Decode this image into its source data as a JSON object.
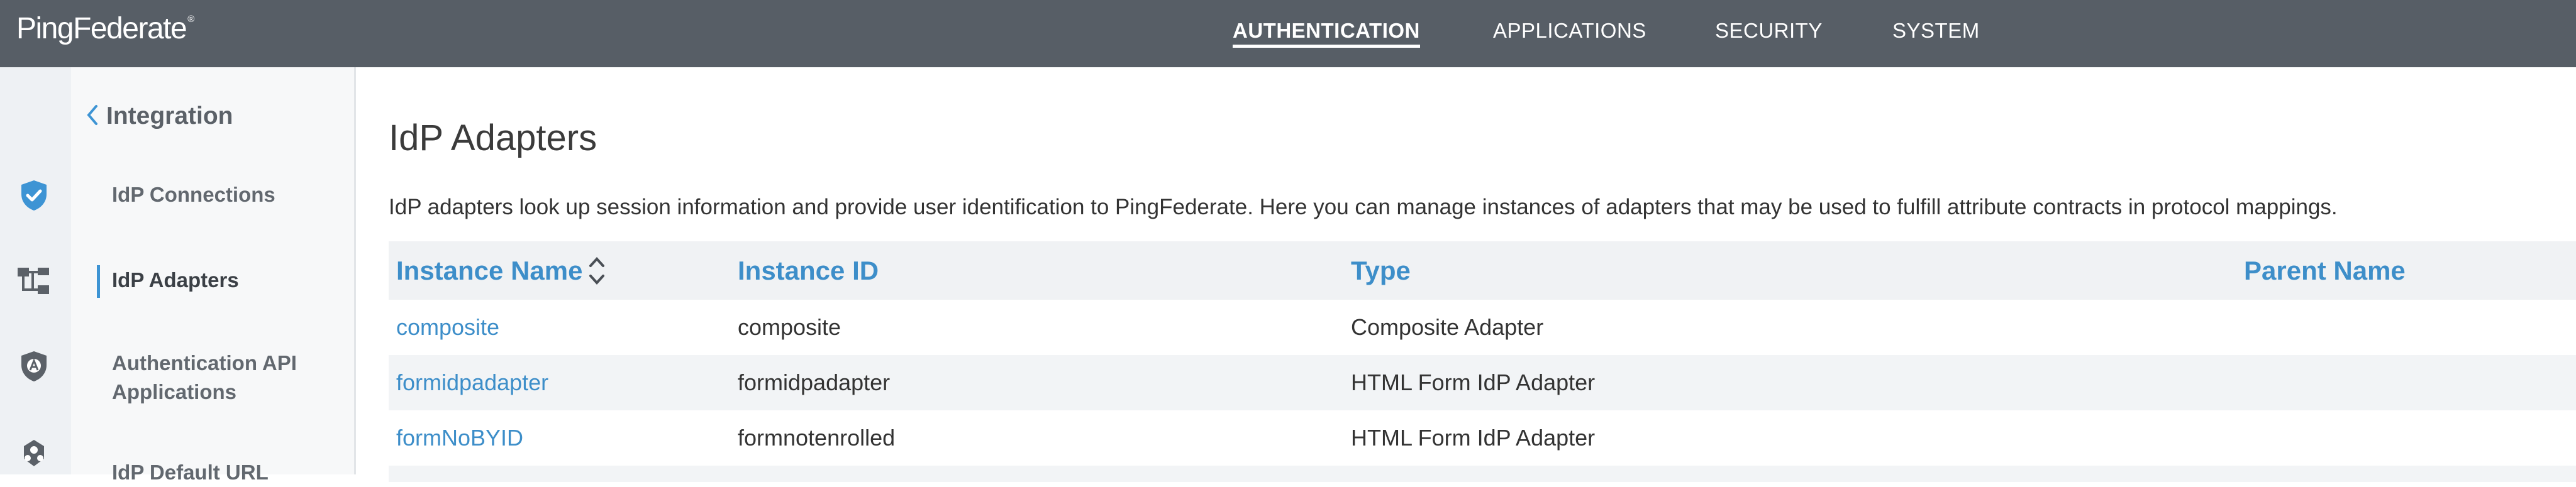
{
  "app": {
    "logo_text": "PingFederate",
    "logo_mark": "®"
  },
  "topnav": {
    "authentication": "AUTHENTICATION",
    "applications": "APPLICATIONS",
    "security": "SECURITY",
    "system": "SYSTEM",
    "active": "AUTHENTICATION"
  },
  "rail": {
    "icons": [
      "shield-check-icon",
      "hierarchy-icon",
      "shield-a-icon",
      "users-icon"
    ]
  },
  "sidenav": {
    "back_label": "Integration",
    "items": [
      {
        "label": "IdP Connections"
      },
      {
        "label": "IdP Adapters",
        "active": true
      },
      {
        "label": "Authentication API"
      },
      {
        "label": "Applications"
      },
      {
        "label": "IdP Default URL"
      }
    ]
  },
  "main": {
    "title": "IdP Adapters",
    "description": "IdP adapters look up session information and provide user identification to PingFederate. Here you can manage instances of adapters that may be used to fulfill attribute contracts in protocol mappings."
  },
  "table": {
    "columns": [
      "Instance Name",
      "Instance ID",
      "Type",
      "Parent Name"
    ],
    "rows": [
      {
        "name": "composite",
        "id": "composite",
        "type": "Composite Adapter",
        "parent": ""
      },
      {
        "name": "formidpadapter",
        "id": "formidpadapter",
        "type": "HTML Form IdP Adapter",
        "parent": ""
      },
      {
        "name": "formNoBYID",
        "id": "formnotenrolled",
        "type": "HTML Form IdP Adapter",
        "parent": ""
      }
    ]
  },
  "colors": {
    "topbar": "#575e66",
    "link": "#3d8ec9",
    "accent": "#3d94d4",
    "sidenav_bg": "#f7f8f9",
    "rail_bg": "#eef1f4"
  }
}
